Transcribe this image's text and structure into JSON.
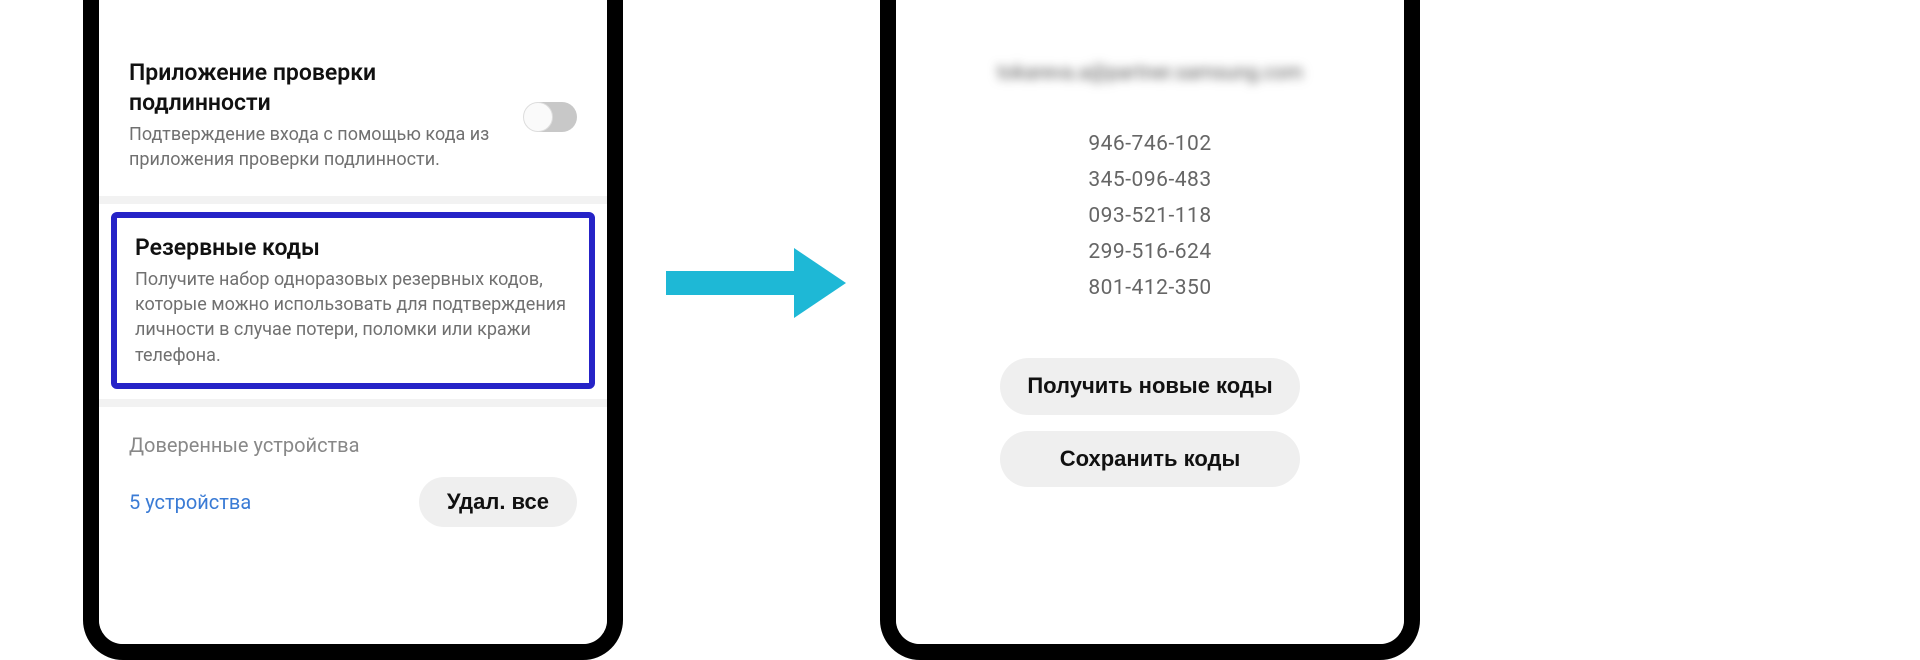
{
  "left": {
    "authApp": {
      "title": "Приложение проверки подлинности",
      "desc": "Подтверждение входа с помощью кода из приложения проверки подлинности."
    },
    "backupCodes": {
      "title": "Резервные коды",
      "desc": "Получите набор одноразовых резервных кодов, которые можно использовать для подтверждения личности в случае потери, поломки или кражи телефона."
    },
    "trustedDevicesHeader": "Доверенные устройства",
    "devicesLink": "5 устройства",
    "deleteAllBtn": "Удал. все"
  },
  "right": {
    "email": "tokareva.a@partner.samsung.com",
    "codes": [
      "946-746-102",
      "345-096-483",
      "093-521-118",
      "299-516-624",
      "801-412-350"
    ],
    "getNewBtn": "Получить новые коды",
    "saveBtn": "Сохранить коды"
  }
}
